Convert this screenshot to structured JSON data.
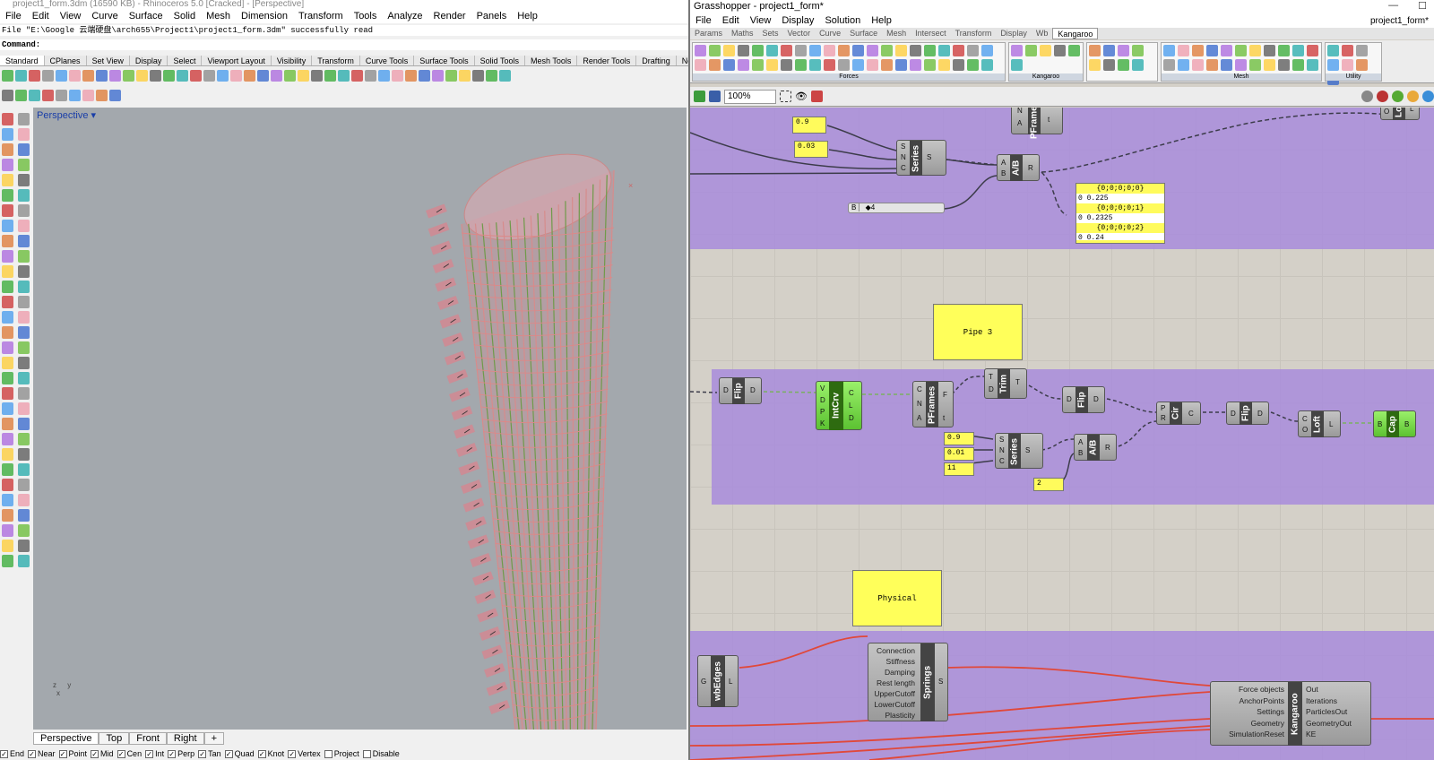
{
  "rhino": {
    "title": "project1_form.3dm (16590 KB) - Rhinoceros 5.0 [Cracked] - [Perspective]",
    "menu": [
      "File",
      "Edit",
      "View",
      "Curve",
      "Surface",
      "Solid",
      "Mesh",
      "Dimension",
      "Transform",
      "Tools",
      "Analyze",
      "Render",
      "Panels",
      "Help"
    ],
    "history": "File \"E:\\Google 云端硬盘\\arch655\\Project1\\project1_form.3dm\" successfully read",
    "command_label": "Command:",
    "toolbar_tabs": [
      "Standard",
      "CPlanes",
      "Set View",
      "Display",
      "Select",
      "Viewport Layout",
      "Visibility",
      "Transform",
      "Curve Tools",
      "Surface Tools",
      "Solid Tools",
      "Mesh Tools",
      "Render Tools",
      "Drafting",
      "Ne"
    ],
    "viewport_label": "Perspective",
    "axis_labels": {
      "z": "z",
      "y": "y",
      "x": "x"
    },
    "view_tabs": [
      "Perspective",
      "Top",
      "Front",
      "Right",
      "+"
    ],
    "osnaps": [
      {
        "label": "End",
        "on": true
      },
      {
        "label": "Near",
        "on": true
      },
      {
        "label": "Point",
        "on": true
      },
      {
        "label": "Mid",
        "on": true
      },
      {
        "label": "Cen",
        "on": true
      },
      {
        "label": "Int",
        "on": true
      },
      {
        "label": "Perp",
        "on": true
      },
      {
        "label": "Tan",
        "on": true
      },
      {
        "label": "Quad",
        "on": true
      },
      {
        "label": "Knot",
        "on": true
      },
      {
        "label": "Vertex",
        "on": true
      },
      {
        "label": "Project",
        "on": false
      },
      {
        "label": "Disable",
        "on": false
      }
    ]
  },
  "gh": {
    "title": "Grasshopper - project1_form*",
    "window_title_right": "project1_form*",
    "menu": [
      "File",
      "Edit",
      "View",
      "Display",
      "Solution",
      "Help"
    ],
    "tabs": [
      "Params",
      "Maths",
      "Sets",
      "Vector",
      "Curve",
      "Surface",
      "Mesh",
      "Intersect",
      "Transform",
      "Display",
      "Wb",
      "Kangaroo"
    ],
    "active_tab": "Kangaroo",
    "ribbon_groups": [
      "Forces",
      "Kangaroo",
      "Mesh",
      "Utility"
    ],
    "zoom": "100%",
    "panels": {
      "p09a": "0.9",
      "p003": "0.03",
      "p09b": "0.9",
      "p001": "0.01",
      "p11": "11",
      "p2": "2",
      "pipe3": "Pipe 3",
      "physical": "Physical"
    },
    "slider": {
      "label": "B",
      "value": "◆4"
    },
    "data_panel": [
      "{0;0;0;0;0}",
      "0 0.225",
      "{0;0;0;0;1}",
      "0 0.2325",
      "{0;0;0;0;2}",
      "0 0.24"
    ],
    "components": {
      "pframes_top": "PFrames",
      "series_top": "Series",
      "ab_top": "A/B",
      "lo_top": "Lo",
      "flip1": "Flip",
      "intcrv": "IntCrv",
      "pframes": "PFrames",
      "trim": "Trim",
      "flip2": "Flip",
      "series": "Series",
      "ab": "A/B",
      "cir": "Cir",
      "flip3": "Flip",
      "loft": "Loft",
      "cap": "Cap",
      "wbedges": "wbEdges",
      "springs": "Springs",
      "kangaroo": "Kangaroo"
    },
    "springs_inputs": [
      "Connection",
      "Stiffness",
      "Damping",
      "Rest length",
      "UpperCutoff",
      "LowerCutoff",
      "Plasticity"
    ],
    "springs_output": "S",
    "kangaroo_inputs": [
      "Force objects",
      "AnchorPoints",
      "Settings",
      "Geometry",
      "SimulationReset"
    ],
    "kangaroo_outputs": [
      "Out",
      "Iterations",
      "ParticlesOut",
      "GeometryOut",
      "KE"
    ]
  }
}
